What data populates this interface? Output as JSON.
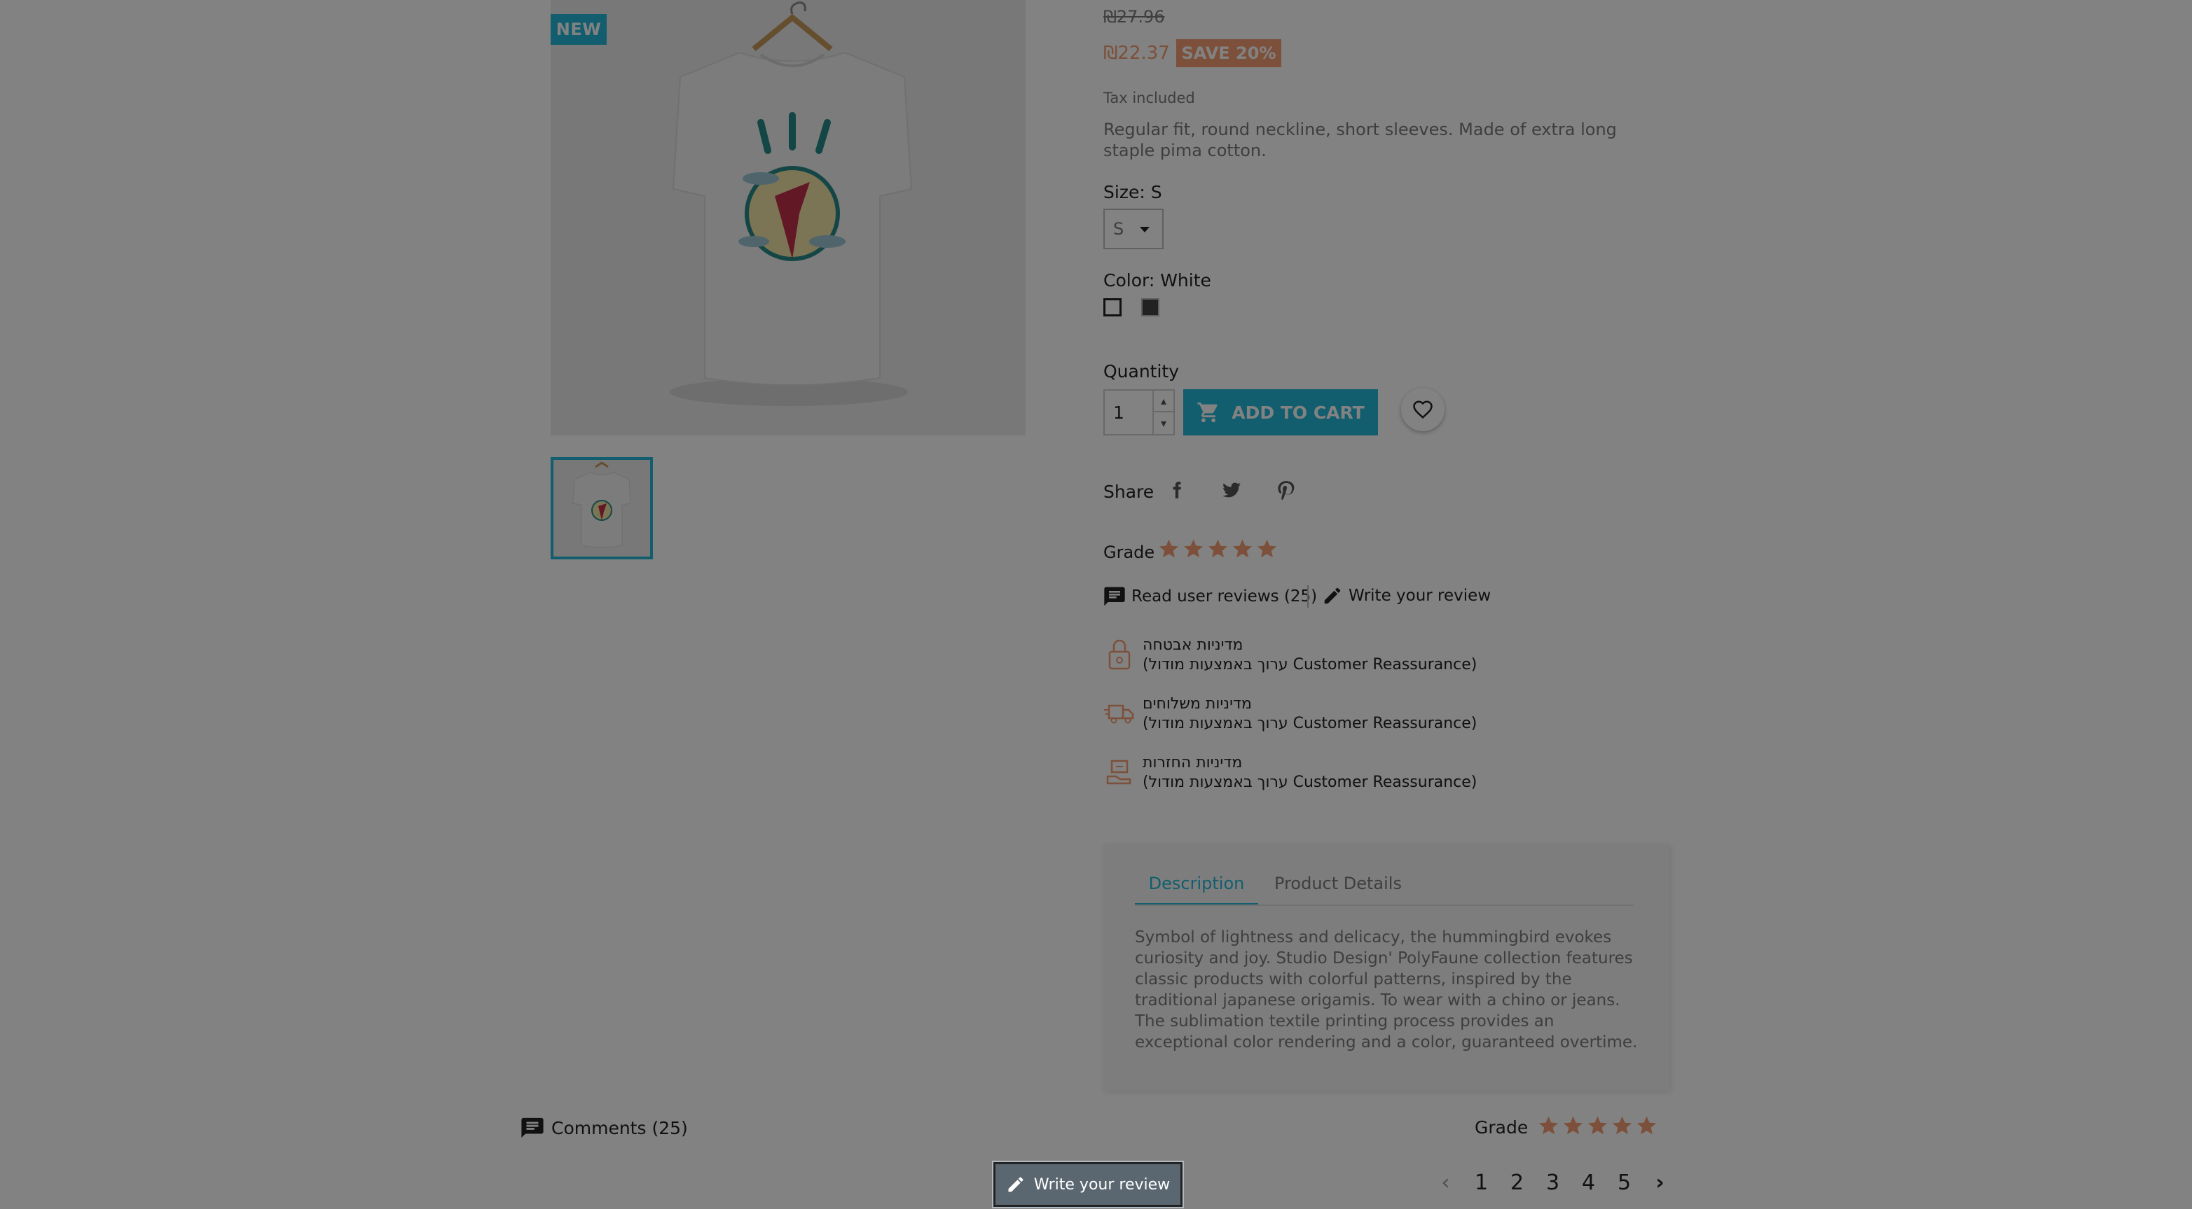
{
  "product": {
    "new_flag": "NEW",
    "old_price": "₪27.96",
    "new_price": "₪22.37",
    "save_badge": "SAVE 20%",
    "tax": "Tax included",
    "short_description": "Regular fit, round neckline, short sleeves. Made of extra long staple pima cotton."
  },
  "variants": {
    "size_label": "Size: S",
    "size_value": "S",
    "color_label": "Color: White"
  },
  "cart": {
    "quantity_label": "Quantity",
    "quantity_value": "1",
    "add_to_cart": "ADD TO CART"
  },
  "share": {
    "label": "Share"
  },
  "rating": {
    "grade_label": "Grade",
    "stars": 5,
    "read_reviews": "Read user reviews (25)",
    "write_review": "Write your review"
  },
  "reassurance": [
    {
      "title": "מדיניות אבטחה",
      "subtitle": "(ערוך באמצעות מודול Customer Reassurance)",
      "icon": "lock-icon"
    },
    {
      "title": "מדיניות משלוחים",
      "subtitle": "(ערוך באמצעות מודול Customer Reassurance)",
      "icon": "truck-icon"
    },
    {
      "title": "מדיניות החזרות",
      "subtitle": "(ערוך באמצעות מודול Customer Reassurance)",
      "icon": "return-icon"
    }
  ],
  "tabs": {
    "description": "Description",
    "product_details": "Product Details",
    "description_text": "Symbol of lightness and delicacy, the hummingbird evokes curiosity and joy. Studio Design' PolyFaune collection features classic products with colorful patterns, inspired by the traditional japanese origamis. To wear with a chino or jeans. The sublimation textile printing process provides an exceptional color rendering and a color, guaranteed overtime."
  },
  "reviews": {
    "comments": "Comments (25)",
    "grade_label": "Grade",
    "write_button": "Write your review",
    "pages": [
      "1",
      "2",
      "3",
      "4",
      "5"
    ],
    "current_page": "1"
  },
  "colors": {
    "accent": "#24b9d7",
    "sale": "#f39d72",
    "overlay": "rgba(0,0,0,0.49)"
  }
}
